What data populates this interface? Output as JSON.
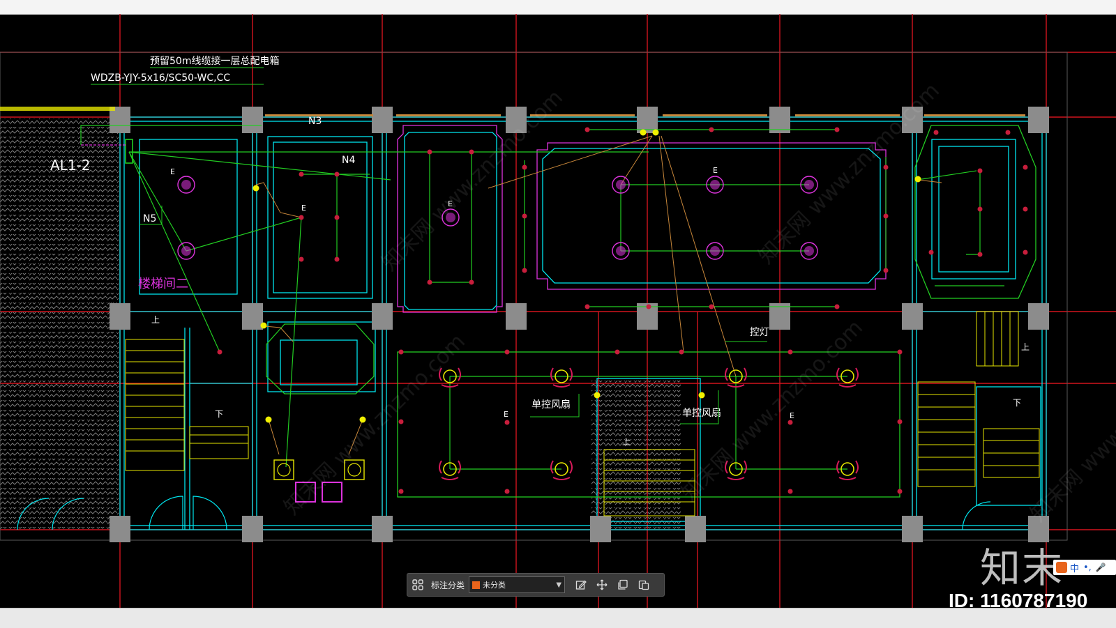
{
  "drawing": {
    "cable_note_line1": "预留50m线缆接一层总配电箱",
    "cable_note_line2": "WDZB-YJY-5x16/SC50-WC,CC",
    "panel_label": "AL1-2",
    "circuit_n3": "N3",
    "circuit_n4": "N4",
    "circuit_n5": "N5",
    "room_stairwell_2": "楼梯间二",
    "switch_label": "控灯",
    "fan_label_1": "单控风扇",
    "fan_label_2": "单控风扇",
    "emergency_tag": "E",
    "stair_up": "上",
    "stair_down": "下"
  },
  "toolbar": {
    "annotation_category_label": "标注分类",
    "category_value": "未分类",
    "icons": [
      "layout-grid-icon",
      "edit-note-icon",
      "move-icon",
      "copy-icon",
      "paste-icon"
    ]
  },
  "watermark": {
    "logo_text": "知末",
    "id_text": "ID: 1160787190",
    "diagonal_text": "知末网 www.znzmo.com"
  },
  "ime": {
    "lang": "中",
    "punct": "•,",
    "mic": "🎤"
  },
  "colors": {
    "grid_line": "#d2141e",
    "wall": "#00ffff",
    "wiring": "#22cc22",
    "fixture": "#dd33dd",
    "column": "#8c8c8c",
    "stairs": "#e6e600",
    "hatch": "#7a7a7a",
    "category_swatch": "#e8641c"
  }
}
